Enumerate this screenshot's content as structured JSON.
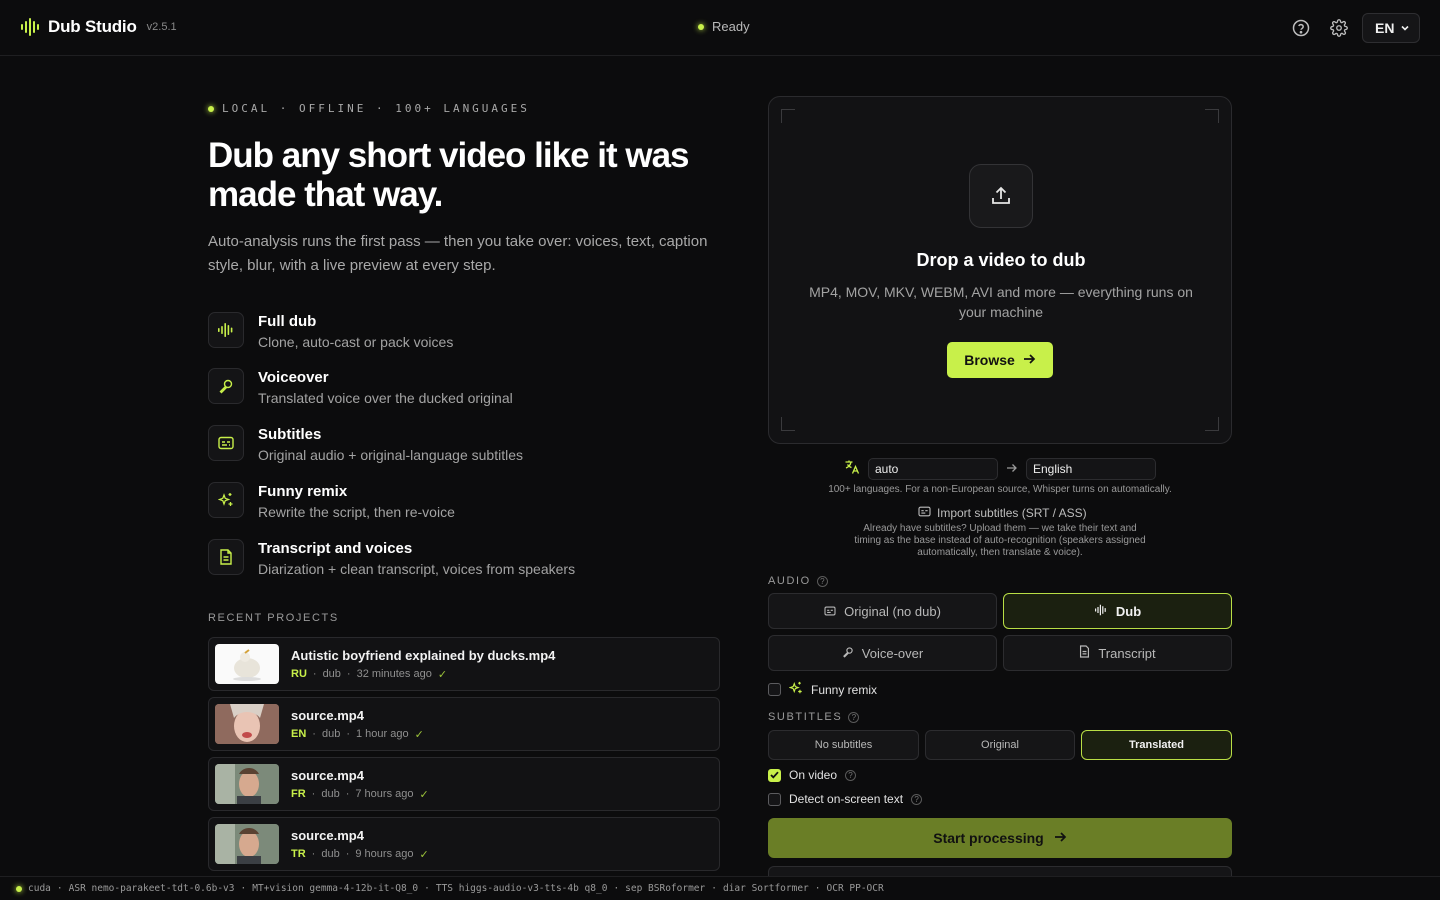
{
  "app": {
    "name": "Dub Studio",
    "version": "v2.5.1",
    "status": "Ready",
    "ui_language": "EN"
  },
  "colors": {
    "accent": "#c8f04a",
    "background": "#0c0c0d",
    "surface": "#121214"
  },
  "hero": {
    "eyebrow": "LOCAL · OFFLINE · 100+ LANGUAGES",
    "title": "Dub any short video like it was made that way.",
    "subtitle": "Auto-analysis runs the first pass — then you take over: voices, text, caption style, blur, with a live preview at every step."
  },
  "features": [
    {
      "title": "Full dub",
      "desc": "Clone, auto-cast or pack voices",
      "icon": "waveform-icon"
    },
    {
      "title": "Voiceover",
      "desc": "Translated voice over the ducked original",
      "icon": "microphone-icon"
    },
    {
      "title": "Subtitles",
      "desc": "Original audio + original-language subtitles",
      "icon": "subtitles-icon"
    },
    {
      "title": "Funny remix",
      "desc": "Rewrite the script, then re-voice",
      "icon": "sparkles-icon"
    },
    {
      "title": "Transcript and voices",
      "desc": "Diarization + clean transcript, voices from speakers",
      "icon": "document-icon"
    }
  ],
  "recent": {
    "label": "RECENT PROJECTS",
    "items": [
      {
        "name": "Autistic boyfriend explained by ducks.mp4",
        "lang": "RU",
        "mode": "dub",
        "time": "32 minutes ago"
      },
      {
        "name": "source.mp4",
        "lang": "EN",
        "mode": "dub",
        "time": "1 hour ago"
      },
      {
        "name": "source.mp4",
        "lang": "FR",
        "mode": "dub",
        "time": "7 hours ago"
      },
      {
        "name": "source.mp4",
        "lang": "TR",
        "mode": "dub",
        "time": "9 hours ago"
      }
    ]
  },
  "dropzone": {
    "title": "Drop a video to dub",
    "subtitle": "MP4, MOV, MKV, WEBM, AVI and more — everything runs on your machine",
    "browse": "Browse"
  },
  "languages": {
    "source": "auto",
    "target": "English",
    "hint": "100+ languages. For a non-European source, Whisper turns on automatically."
  },
  "import": {
    "label": "Import subtitles (SRT / ASS)",
    "hint": "Already have subtitles? Upload them — we take their text and timing as the base instead of auto-recognition (speakers assigned automatically, then translate & voice)."
  },
  "audio": {
    "label": "AUDIO",
    "options": [
      "Original (no dub)",
      "Dub",
      "Voice-over",
      "Transcript"
    ],
    "selected": "Dub",
    "funny_remix": "Funny remix"
  },
  "subtitles": {
    "label": "SUBTITLES",
    "options": [
      "No subtitles",
      "Original",
      "Translated"
    ],
    "selected": "Translated",
    "on_video": "On video",
    "detect_text": "Detect on-screen text"
  },
  "start": "Start processing",
  "footer": {
    "device": "cuda",
    "items": [
      "ASR nemo-parakeet-tdt-0.6b-v3",
      "MT+vision gemma-4-12b-it-Q8_0",
      "TTS higgs-audio-v3-tts-4b q8_0",
      "sep BSRoformer",
      "diar Sortformer",
      "OCR PP-OCR"
    ]
  }
}
